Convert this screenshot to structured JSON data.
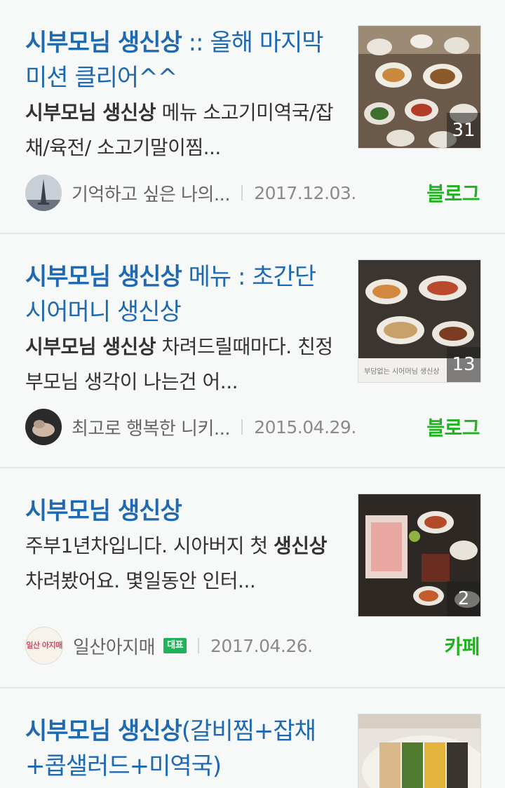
{
  "results": [
    {
      "title_bold": "시부모님 생신상",
      "title_rest": " :: 올해 마지막 미션 클리어^^",
      "snippet_bold1": "시부모님 생신상",
      "snippet_rest": " 메뉴 소고기미역국/잡채/육전/ 소고기말이찜...",
      "author": "기억하고 싶은 나의...",
      "date": "2017.12.03.",
      "source": "블로그",
      "photo_count": "31"
    },
    {
      "title_bold": "시부모님 생신상",
      "title_rest": " 메뉴 : 초간단 시어머니 생신상",
      "snippet_bold1": "시부모님 생신상",
      "snippet_rest": " 차려드릴때마다. 친정 부모님 생각이 나는건 어...",
      "author": "최고로 행복한 니키...",
      "date": "2015.04.29.",
      "source": "블로그",
      "photo_count": "13",
      "thumb_caption": "부담없는 시어머님 생신상"
    },
    {
      "title_bold": "시부모님 생신상",
      "title_rest": "",
      "snippet_pre": "주부1년차입니다. 시아버지 첫 ",
      "snippet_bold1": "생신상",
      "snippet_rest": " 차려봤어요. 몇일동안 인터...",
      "author": "일산아지매",
      "badge": "대표",
      "avatar_text": "일산 아지매",
      "date": "2017.04.26.",
      "source": "카페",
      "photo_count": "2"
    },
    {
      "title_bold": "시부모님 생신상",
      "title_rest": "(갈비찜+잡채+콥샐러드+미역국)"
    }
  ]
}
